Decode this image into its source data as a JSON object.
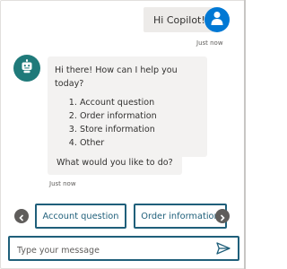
{
  "user_message": {
    "text": "Hi Copilot!",
    "timestamp": "Just now"
  },
  "bot_messages": {
    "greeting": "Hi there! How can I help you today?",
    "options": [
      "Account question",
      "Order information",
      "Store information",
      "Other"
    ],
    "follow_up": "What would you like to do?",
    "timestamp": "Just now"
  },
  "suggested_actions": [
    "Account question",
    "Order information"
  ],
  "input": {
    "placeholder": "Type your message",
    "value": ""
  },
  "colors": {
    "user_avatar": "#0078d4",
    "bot_avatar": "#1f7a7a",
    "accent_border": "#1f5f7a",
    "bubble": "#f3f2f1",
    "nav_button": "#5f5d5b"
  },
  "icons": {
    "user_avatar": "person-icon",
    "bot_avatar": "robot-icon",
    "prev": "chevron-left-icon",
    "next": "chevron-right-icon",
    "send": "send-icon"
  }
}
